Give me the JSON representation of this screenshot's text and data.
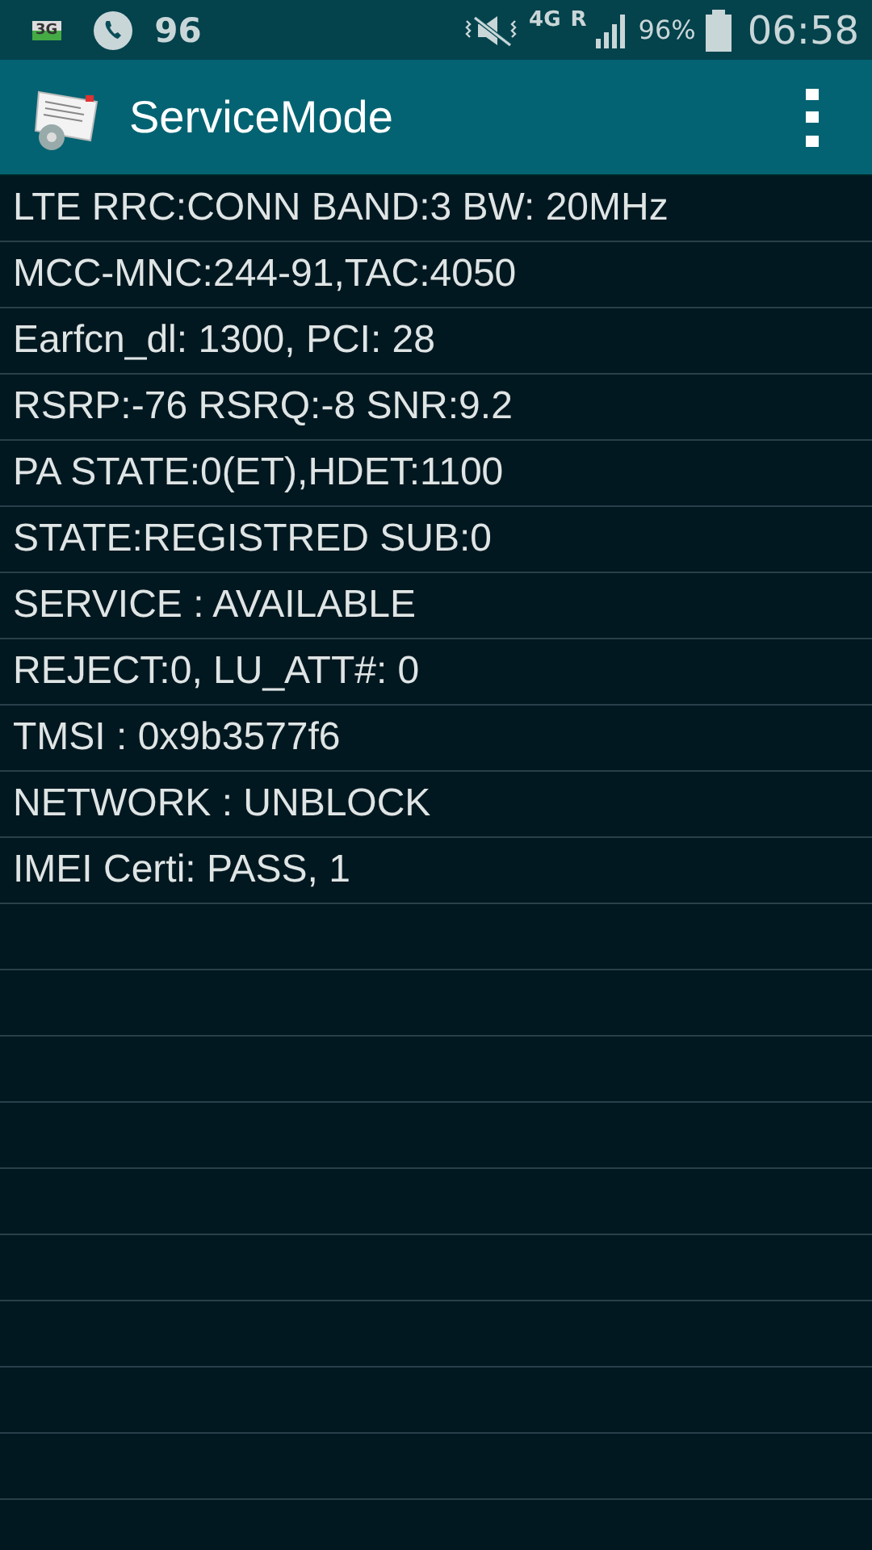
{
  "status_bar": {
    "sim_label": "3G",
    "call_count": "96",
    "network": "4G",
    "roaming": "R",
    "battery": "96%",
    "time": "06:58"
  },
  "app_bar": {
    "title": "ServiceMode"
  },
  "lines": [
    "LTE RRC:CONN BAND:3 BW: 20MHz",
    "MCC-MNC:244-91,TAC:4050",
    "Earfcn_dl: 1300, PCI: 28",
    "RSRP:-76 RSRQ:-8 SNR:9.2",
    "PA STATE:0(ET),HDET:1100",
    "STATE:REGISTRED SUB:0",
    "SERVICE : AVAILABLE",
    "REJECT:0, LU_ATT#: 0",
    "TMSI : 0x9b3577f6",
    "NETWORK : UNBLOCK",
    "IMEI Certi: PASS, 1"
  ]
}
